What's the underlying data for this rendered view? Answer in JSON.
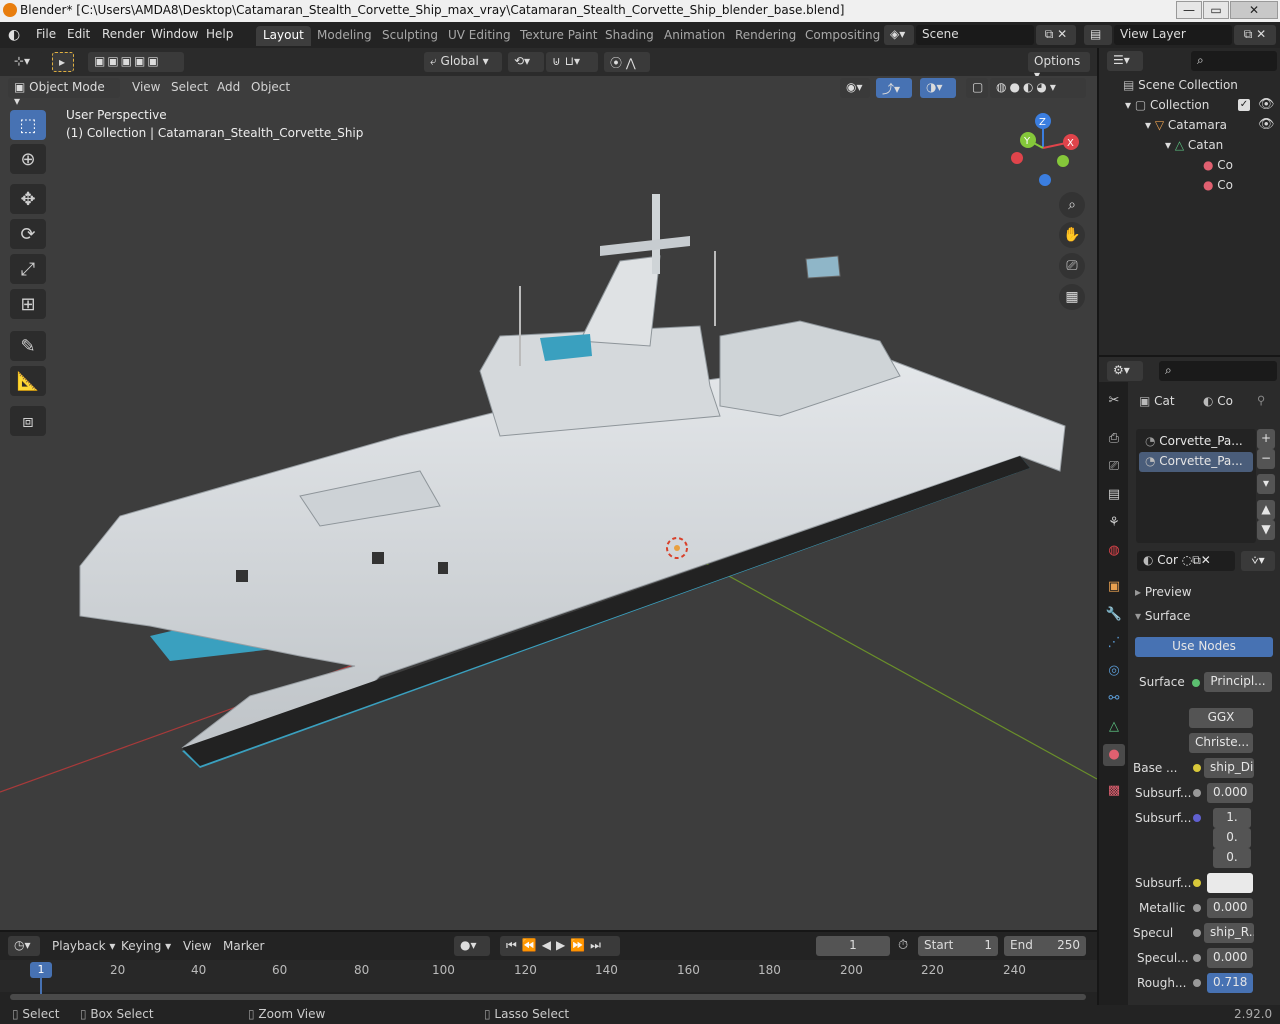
{
  "window": {
    "title": "Blender* [C:\\Users\\AMDA8\\Desktop\\Catamaran_Stealth_Corvette_Ship_max_vray\\Catamaran_Stealth_Corvette_Ship_blender_base.blend]",
    "minimize": "—",
    "maximize": "▭",
    "close": "✕"
  },
  "menu": {
    "items": [
      "File",
      "Edit",
      "Render",
      "Window",
      "Help"
    ]
  },
  "workspaces": [
    "Layout",
    "Modeling",
    "Sculpting",
    "UV Editing",
    "Texture Paint",
    "Shading",
    "Animation",
    "Rendering",
    "Compositing"
  ],
  "active_workspace": "Layout",
  "scene": "Scene",
  "view_layer": "View Layer",
  "viewport_header": {
    "mode": "Object Mode",
    "menus": [
      "View",
      "Select",
      "Add",
      "Object"
    ],
    "transform": "Global",
    "options": "Options"
  },
  "viewport": {
    "overlay_line1": "User Perspective",
    "overlay_line2": "(1) Collection | Catamaran_Stealth_Corvette_Ship",
    "gizmo": {
      "x": "X",
      "y": "Y",
      "z": "Z"
    }
  },
  "outliner": {
    "items": [
      {
        "label": "Scene Collection"
      },
      {
        "label": "Collection"
      },
      {
        "label": "Catamara"
      },
      {
        "label": "Catan"
      },
      {
        "label": "Co"
      },
      {
        "label": "Co"
      }
    ]
  },
  "properties": {
    "header_left": "Cat",
    "header_right": "Co",
    "slots": [
      "Corvette_Pa...",
      "Corvette_Pa..."
    ],
    "material_name": "Cor",
    "preview": "Preview",
    "surface_panel": "Surface",
    "use_nodes": "Use Nodes",
    "rows": [
      {
        "label": "Surface",
        "value": "Principl..."
      },
      {
        "label": "",
        "value": "GGX"
      },
      {
        "label": "",
        "value": "Christe..."
      },
      {
        "label": "Base ...",
        "value": "ship_Di..."
      },
      {
        "label": "Subsurf...",
        "value": "0.000"
      },
      {
        "label": "Subsurf...",
        "value": "1."
      },
      {
        "label": "",
        "value": "0."
      },
      {
        "label": "",
        "value": "0."
      },
      {
        "label": "Subsurf...",
        "value": ""
      },
      {
        "label": "Metallic",
        "value": "0.000"
      },
      {
        "label": "Specul",
        "value": "ship_R..."
      },
      {
        "label": "Specul...",
        "value": "0.000"
      },
      {
        "label": "Rough...",
        "value": "0.718"
      }
    ]
  },
  "timeline": {
    "menus": [
      "Playback",
      "Keying",
      "View",
      "Marker"
    ],
    "current_frame": "1",
    "start_label": "Start",
    "start": "1",
    "end_label": "End",
    "end": "250",
    "ticks": [
      "1",
      "20",
      "40",
      "60",
      "80",
      "100",
      "120",
      "140",
      "160",
      "180",
      "200",
      "220",
      "240"
    ]
  },
  "status": {
    "select": "Select",
    "box_select": "Box Select",
    "zoom_view": "Zoom View",
    "lasso_select": "Lasso Select",
    "version": "2.92.0"
  },
  "colors": {
    "accent": "#4772b3",
    "hull_cyan": "#3aa0bf",
    "ship_white": "#d9dde0"
  }
}
